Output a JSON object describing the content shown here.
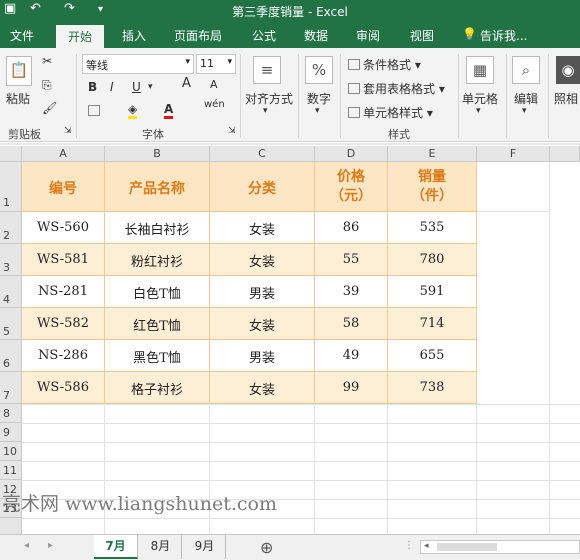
{
  "titlebar": {
    "title": "第三季度销量 - Excel",
    "quick_access": [
      "↶",
      "↷"
    ]
  },
  "ribbon_tabs": [
    {
      "label": "文件"
    },
    {
      "label": "开始",
      "active": true
    },
    {
      "label": "插入"
    },
    {
      "label": "页面布局"
    },
    {
      "label": "公式"
    },
    {
      "label": "数据"
    },
    {
      "label": "审阅"
    },
    {
      "label": "视图"
    },
    {
      "label": "告诉我..."
    }
  ],
  "ribbon": {
    "clipboard": {
      "paste": "粘贴",
      "group": "剪贴板"
    },
    "font": {
      "name": "等线",
      "size": "11",
      "grow": "A",
      "shrink": "A",
      "bold": "B",
      "italic": "I",
      "underline": "U",
      "wen": "wén",
      "group": "字体"
    },
    "alignment": {
      "label": "对齐方式"
    },
    "number": {
      "symbol": "%",
      "label": "数字"
    },
    "styles": {
      "conditional": "条件格式",
      "table": "套用表格格式",
      "cell_styles": "单元格样式",
      "group": "样式"
    },
    "cells": {
      "label": "单元格"
    },
    "editing": {
      "label": "编辑"
    },
    "photo": {
      "label": "照相"
    }
  },
  "columns": [
    "A",
    "B",
    "C",
    "D",
    "E",
    "F"
  ],
  "rows": [
    "1",
    "2",
    "3",
    "4",
    "5",
    "6",
    "7",
    "8",
    "9",
    "10",
    "11",
    "12",
    "13"
  ],
  "table": {
    "headers": [
      "编号",
      "产品名称",
      "分类",
      "价格\n（元）",
      "销量\n（件）"
    ],
    "rows": [
      [
        "WS-560",
        "长袖白衬衫",
        "女装",
        "86",
        "535"
      ],
      [
        "WS-581",
        "粉红衬衫",
        "女装",
        "55",
        "780"
      ],
      [
        "NS-281",
        "白色T恤",
        "男装",
        "39",
        "591"
      ],
      [
        "WS-582",
        "红色T恤",
        "女装",
        "58",
        "714"
      ],
      [
        "NS-286",
        "黑色T恤",
        "男装",
        "49",
        "655"
      ],
      [
        "WS-586",
        "格子衬衫",
        "女装",
        "99",
        "738"
      ]
    ]
  },
  "sheet_tabs": [
    {
      "label": "7月",
      "active": true
    },
    {
      "label": "8月"
    },
    {
      "label": "9月"
    }
  ],
  "add_sheet": "⊕",
  "watermark": "亮术网 www.liangshunet.com",
  "colors": {
    "accent": "#217346",
    "header_fill": "#fde6c3",
    "header_text": "#e07b17",
    "band_fill": "#fdeed6"
  }
}
